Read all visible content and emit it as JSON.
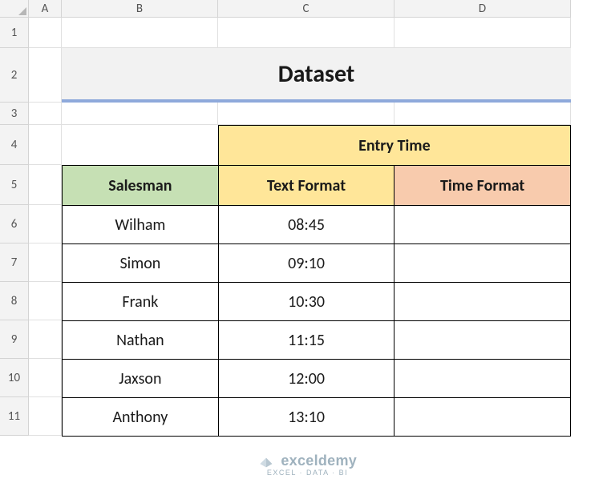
{
  "columns": [
    "A",
    "B",
    "C",
    "D"
  ],
  "rows": [
    "1",
    "2",
    "3",
    "4",
    "5",
    "6",
    "7",
    "8",
    "9",
    "10",
    "11"
  ],
  "title": "Dataset",
  "headers": {
    "entry_time": "Entry Time",
    "salesman": "Salesman",
    "text_format": "Text Format",
    "time_format": "Time Format"
  },
  "data": [
    {
      "salesman": "Wilham",
      "text_format": "08:45",
      "time_format": ""
    },
    {
      "salesman": "Simon",
      "text_format": "09:10",
      "time_format": ""
    },
    {
      "salesman": "Frank",
      "text_format": "10:30",
      "time_format": ""
    },
    {
      "salesman": "Nathan",
      "text_format": "11:15",
      "time_format": ""
    },
    {
      "salesman": "Jaxson",
      "text_format": "12:00",
      "time_format": ""
    },
    {
      "salesman": "Anthony",
      "text_format": "13:10",
      "time_format": ""
    }
  ],
  "watermark": {
    "brand": "exceldemy",
    "tagline": "EXCEL · DATA · BI"
  },
  "chart_data": {
    "type": "table",
    "title": "Dataset",
    "columns": [
      "Salesman",
      "Text Format",
      "Time Format"
    ],
    "rows": [
      [
        "Wilham",
        "08:45",
        ""
      ],
      [
        "Simon",
        "09:10",
        ""
      ],
      [
        "Frank",
        "10:30",
        ""
      ],
      [
        "Nathan",
        "11:15",
        ""
      ],
      [
        "Jaxson",
        "12:00",
        ""
      ],
      [
        "Anthony",
        "13:10",
        ""
      ]
    ]
  }
}
